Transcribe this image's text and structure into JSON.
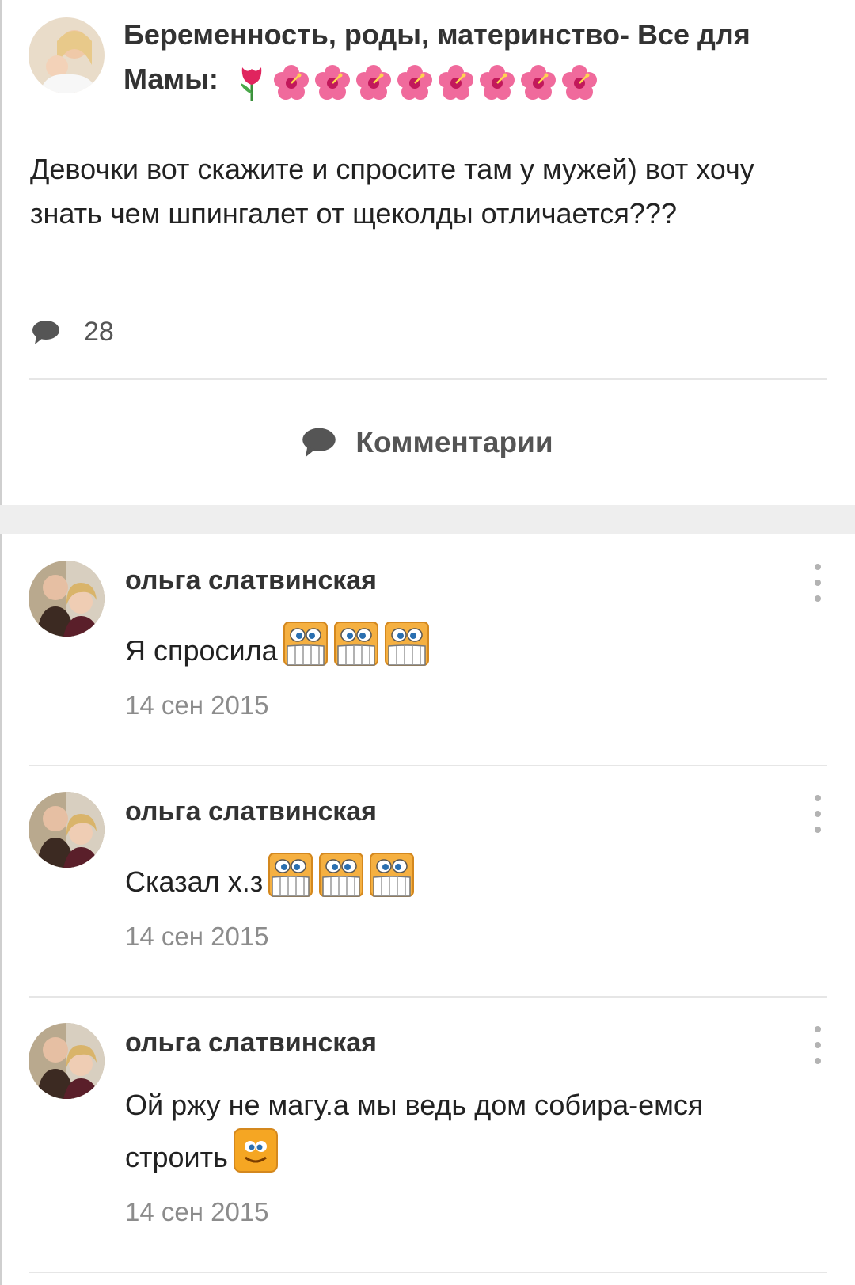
{
  "post": {
    "group_title": "Беременность, роды, материнство- Все для Мамы:",
    "title_emojis": [
      "tulip-emoji",
      "hibiscus-emoji",
      "hibiscus-emoji",
      "hibiscus-emoji",
      "hibiscus-emoji",
      "hibiscus-emoji",
      "hibiscus-emoji",
      "hibiscus-emoji",
      "hibiscus-emoji"
    ],
    "text": "Девочки вот скажите и спросите там у мужей) вот хочу знать чем шпингалет от щеколды отличается???",
    "comment_count": "28",
    "comments_label": "Комментарии"
  },
  "comments": [
    {
      "author": "ольга слатвинская",
      "text": "Я спросила",
      "emojis": [
        "grin-emoji",
        "grin-emoji",
        "grin-emoji"
      ],
      "time": "14 сен 2015"
    },
    {
      "author": "ольга слатвинская",
      "text": "Сказал х.з",
      "emojis": [
        "grin-emoji",
        "grin-emoji",
        "grin-emoji"
      ],
      "time": "14 сен 2015"
    },
    {
      "author": "ольга слатвинская",
      "text": "Ой ржу не магу.а мы ведь дом собира-емся строить",
      "emojis": [
        "smile-emoji"
      ],
      "time": "14 сен 2015"
    }
  ],
  "colors": {
    "accent_text": "#333333",
    "muted": "#8c8c8c",
    "band": "#eeeeee"
  }
}
